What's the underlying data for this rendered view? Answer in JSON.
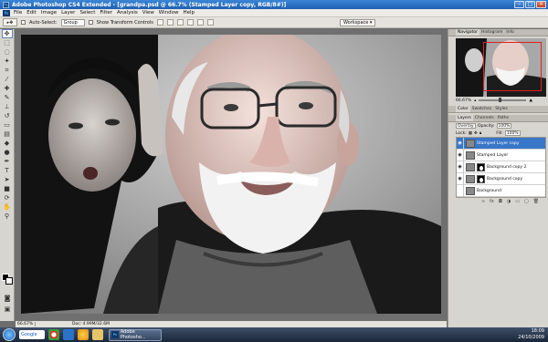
{
  "window": {
    "title": "Adobe Photoshop CS4 Extended - [grandpa.psd @ 66.7% (Stamped Layer copy, RGB/8#)]"
  },
  "menu": [
    "File",
    "Edit",
    "Image",
    "Layer",
    "Select",
    "Filter",
    "Analysis",
    "View",
    "Window",
    "Help"
  ],
  "options": {
    "auto_select_label": "Auto-Select:",
    "auto_select_value": "Group",
    "transform_label": "Show Transform Controls",
    "workspace_label": "Workspace ▾"
  },
  "status": {
    "zoom": "66.67%",
    "doc": "Doc: 4.99M/32.6M"
  },
  "navigator": {
    "tabs": [
      "Navigator",
      "Histogram",
      "Info"
    ],
    "zoom": "66.67%"
  },
  "color_panel": {
    "tabs": [
      "Color",
      "Swatches",
      "Styles"
    ]
  },
  "layers_panel": {
    "tabs": [
      "Layers",
      "Channels",
      "Paths"
    ],
    "blend_mode": "Overlay",
    "opacity_label": "Opacity:",
    "opacity": "100%",
    "lock_label": "Lock:",
    "fill_label": "Fill:",
    "fill": "100%",
    "layers": [
      {
        "name": "Stamped Layer copy",
        "selected": true,
        "mask": false
      },
      {
        "name": "Stamped Layer",
        "selected": false,
        "mask": false
      },
      {
        "name": "Background copy 2",
        "selected": false,
        "mask": true
      },
      {
        "name": "Background copy",
        "selected": false,
        "mask": true
      },
      {
        "name": "Background",
        "selected": false,
        "mask": false
      }
    ]
  },
  "taskbar": {
    "search": "Google",
    "task_label": "Adobe Photosho...",
    "time": "18:09",
    "date": "24/10/2009"
  }
}
